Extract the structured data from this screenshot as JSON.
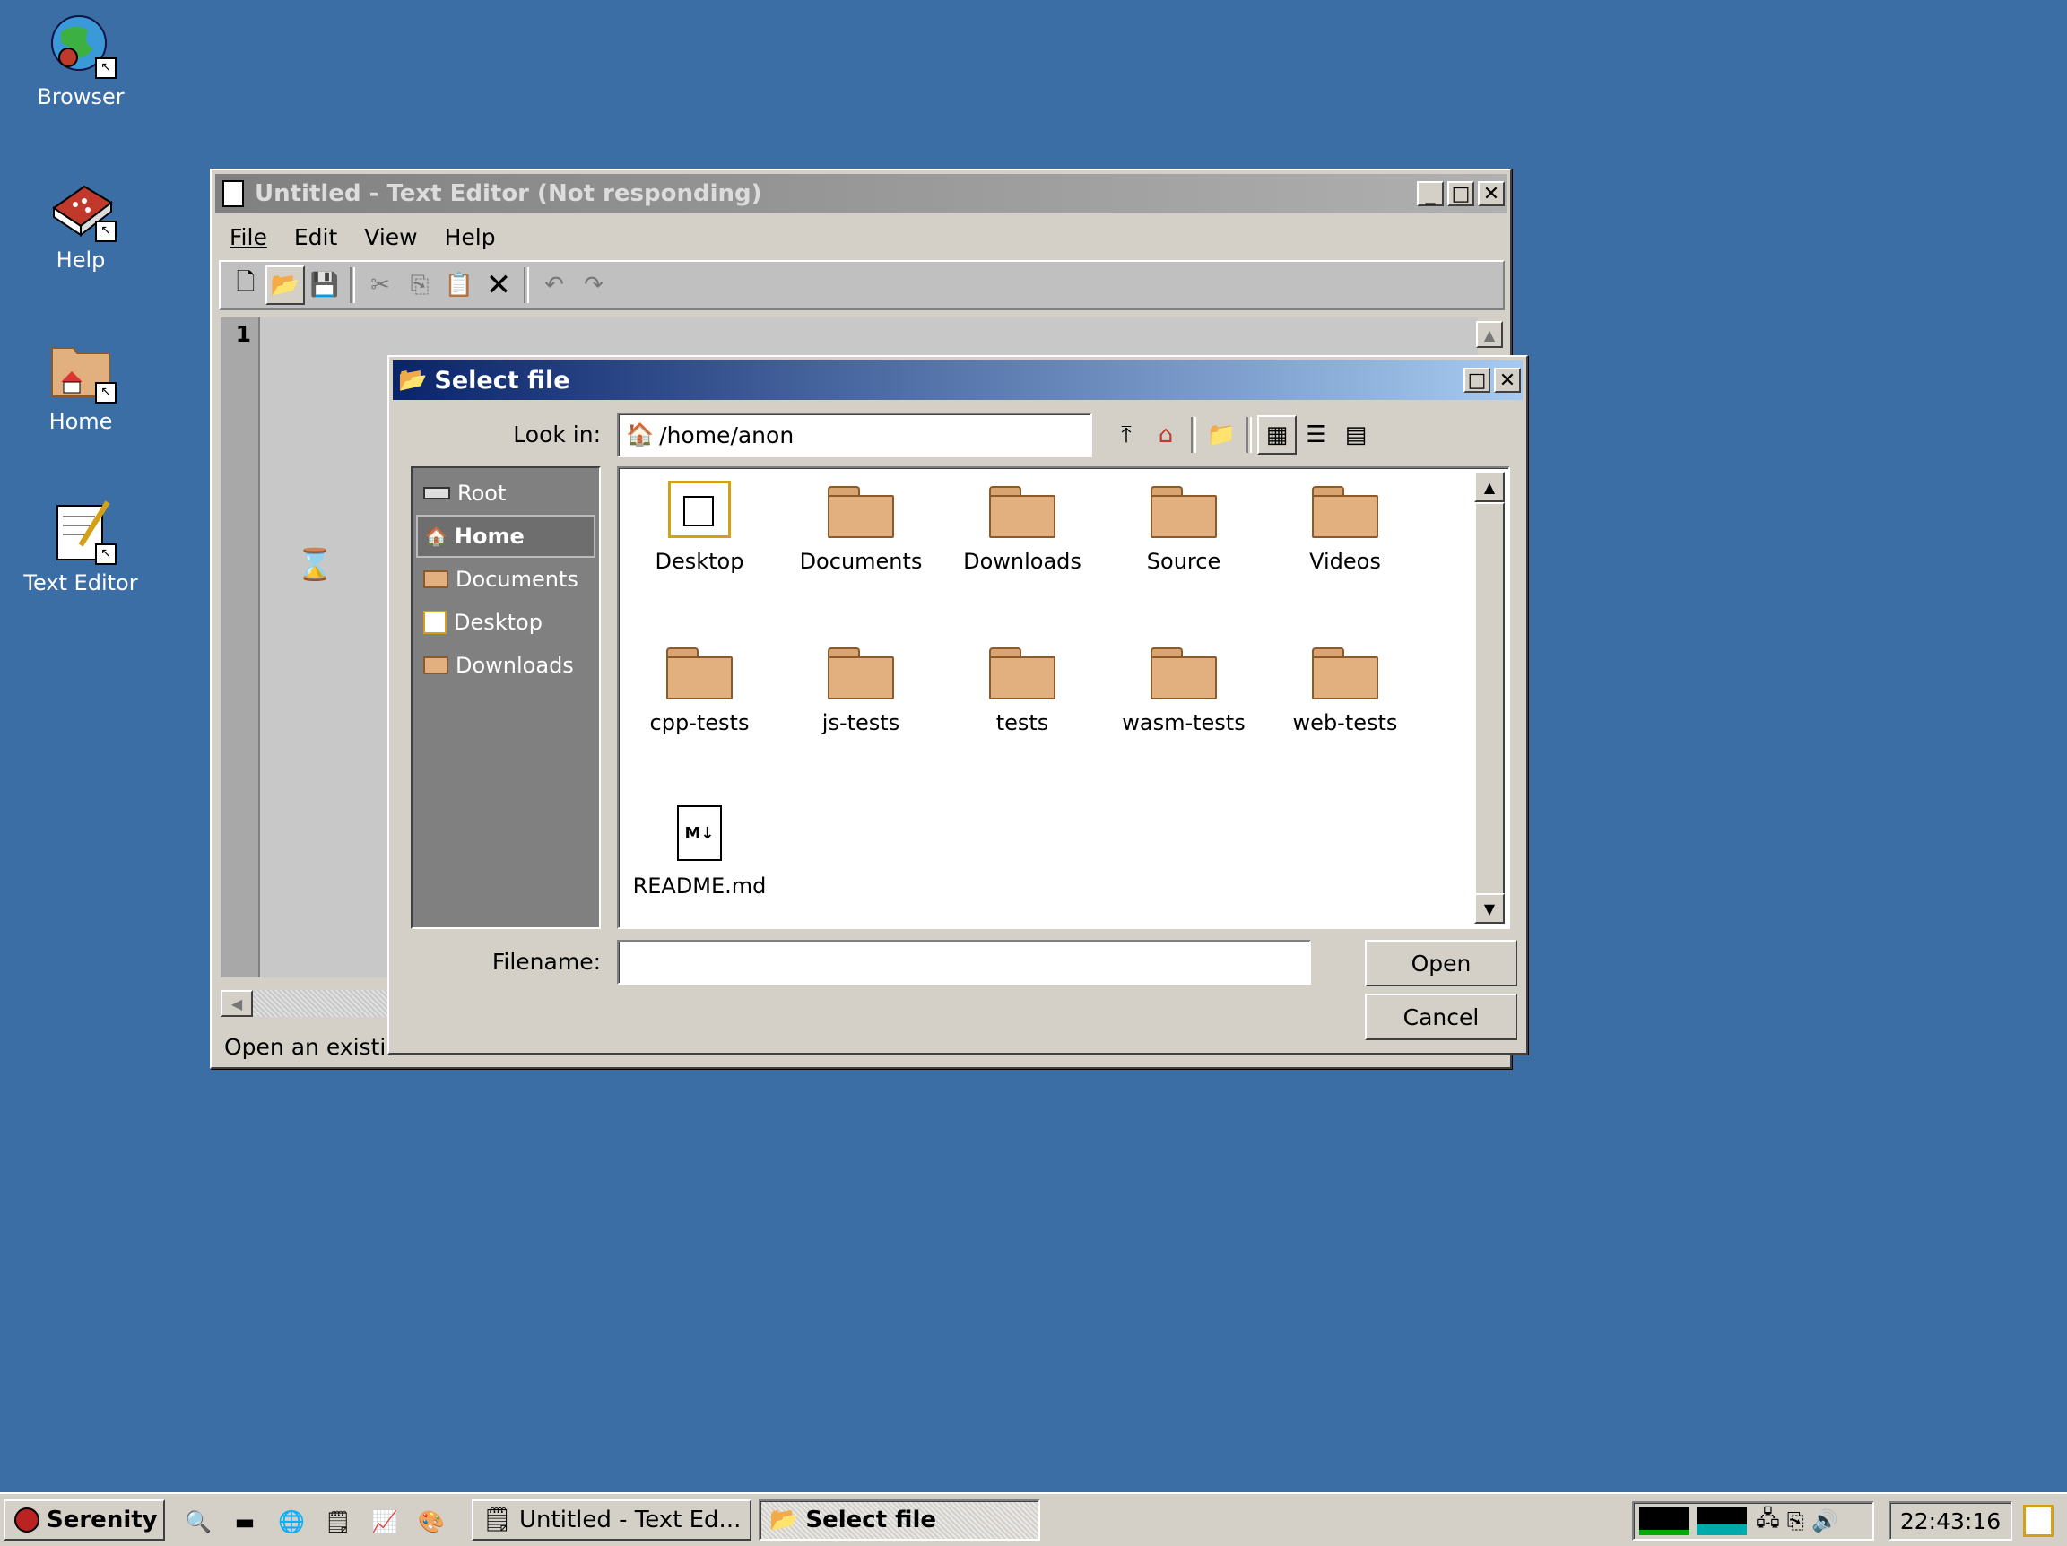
{
  "desktop": {
    "icons": [
      {
        "label": "Browser",
        "icon": "globe-icon"
      },
      {
        "label": "Help",
        "icon": "help-book-icon"
      },
      {
        "label": "Home",
        "icon": "home-folder-icon"
      },
      {
        "label": "Text Editor",
        "icon": "text-editor-icon"
      }
    ]
  },
  "editor": {
    "title": "Untitled - Text Editor (Not responding)",
    "menu": [
      "File",
      "Edit",
      "View",
      "Help"
    ],
    "line_number": "1",
    "status": "Open an existir"
  },
  "dialog": {
    "title": "Select file",
    "look_in_label": "Look in:",
    "path": "/home/anon",
    "sidebar": [
      {
        "label": "Root",
        "icon": "drive-icon"
      },
      {
        "label": "Home",
        "icon": "home-folder-icon",
        "selected": true
      },
      {
        "label": "Documents",
        "icon": "folder-icon"
      },
      {
        "label": "Desktop",
        "icon": "desktop-icon"
      },
      {
        "label": "Downloads",
        "icon": "folder-icon"
      }
    ],
    "files": [
      {
        "label": "Desktop",
        "icon": "desktop-icon"
      },
      {
        "label": "Documents",
        "icon": "folder-icon"
      },
      {
        "label": "Downloads",
        "icon": "folder-icon"
      },
      {
        "label": "Source",
        "icon": "folder-icon"
      },
      {
        "label": "Videos",
        "icon": "folder-icon"
      },
      {
        "label": "cpp-tests",
        "icon": "folder-icon"
      },
      {
        "label": "js-tests",
        "icon": "folder-icon"
      },
      {
        "label": "tests",
        "icon": "folder-icon"
      },
      {
        "label": "wasm-tests",
        "icon": "folder-icon"
      },
      {
        "label": "web-tests",
        "icon": "folder-icon"
      },
      {
        "label": "README.md",
        "icon": "markdown-file-icon"
      }
    ],
    "filename_label": "Filename:",
    "filename_value": "",
    "open_label": "Open",
    "cancel_label": "Cancel"
  },
  "taskbar": {
    "start_label": "Serenity",
    "tasks": [
      "Untitled - Text Ed...",
      "Select file"
    ],
    "clock": "22:43:16"
  },
  "colors": {
    "desktop_bg": "#3b6ea5",
    "active_title_start": "#0a246a",
    "active_title_end": "#a6caf0",
    "inactive_title": "#808080",
    "sidebar_bg": "#808080",
    "folder_fill": "#e2b07e"
  }
}
